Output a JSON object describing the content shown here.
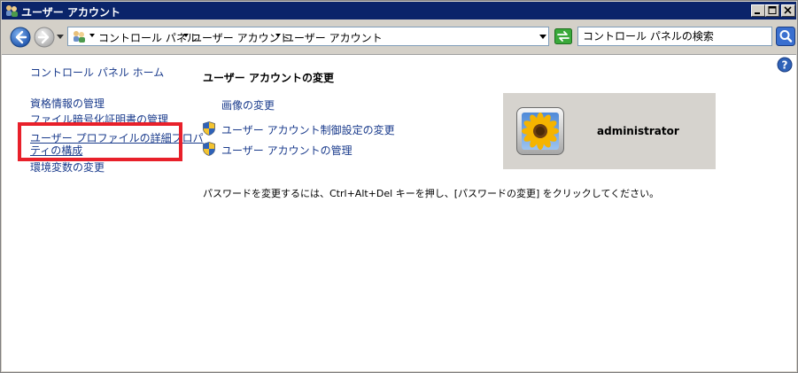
{
  "window": {
    "title": "ユーザー アカウント"
  },
  "nav": {
    "breadcrumbs": [
      "コントロール パネル",
      "ユーザー アカウント",
      "ユーザー アカウント"
    ],
    "search_placeholder": "コントロール パネルの検索"
  },
  "sidebar": {
    "items": [
      {
        "label": "コントロール パネル ホーム"
      },
      {
        "label": "資格情報の管理"
      },
      {
        "label": "ファイル暗号化証明書の管理"
      },
      {
        "label": "ユーザー プロファイルの詳細プロパ"
      },
      {
        "label": "ティの構成"
      },
      {
        "label": "環境変数の変更"
      }
    ]
  },
  "main": {
    "title": "ユーザー アカウントの変更",
    "actions": [
      {
        "label": "画像の変更"
      },
      {
        "label": "ユーザー アカウント制御設定の変更"
      },
      {
        "label": "ユーザー アカウントの管理"
      }
    ],
    "account": {
      "name": "administrator"
    },
    "note": "パスワードを変更するには、Ctrl+Alt+Del キーを押し、[パスワードの変更] をクリックしてください。"
  },
  "colors": {
    "titlebar": "#0a246a",
    "link": "#1a3b8c",
    "highlight": "#e8202a"
  }
}
